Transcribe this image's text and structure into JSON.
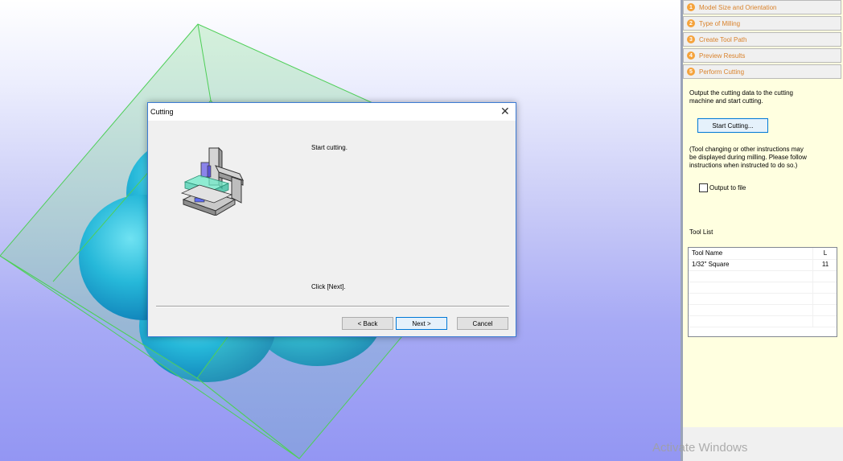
{
  "dialog": {
    "title": "Cutting",
    "close_icon": "✕",
    "message_top": "Start cutting.",
    "message_bottom": "Click [Next].",
    "back_label": "< Back",
    "next_label": "Next >",
    "cancel_label": "Cancel"
  },
  "panel": {
    "steps": [
      {
        "num": "1",
        "label": "Model Size and Orientation"
      },
      {
        "num": "2",
        "label": "Type of Milling"
      },
      {
        "num": "3",
        "label": "Create Tool Path"
      },
      {
        "num": "4",
        "label": "Preview Results"
      },
      {
        "num": "5",
        "label": "Perform Cutting"
      }
    ],
    "desc1_line1": "Output the cutting data to the cutting",
    "desc1_line2": "machine and start cutting.",
    "start_cutting_label": "Start Cutting...",
    "desc2_line1": "(Tool changing or other instructions may",
    "desc2_line2": "be displayed during milling. Please follow",
    "desc2_line3": "instructions when instructed to do so.)",
    "output_to_file_label": "Output to file",
    "output_to_file_checked": false,
    "tool_list_label": "Tool List",
    "tool_table": {
      "headers": [
        "Tool Name",
        "L"
      ],
      "rows": [
        [
          "1/32\" Square",
          "11"
        ]
      ]
    }
  },
  "watermark": "Activate Windows",
  "colors": {
    "accent_step": "#d9822b",
    "dialog_border": "#3c7bd4",
    "model_fill": "#22b6d8",
    "bounding_box": "#4fcf58"
  },
  "icons": {
    "milling_machine": "milling-machine-icon"
  }
}
